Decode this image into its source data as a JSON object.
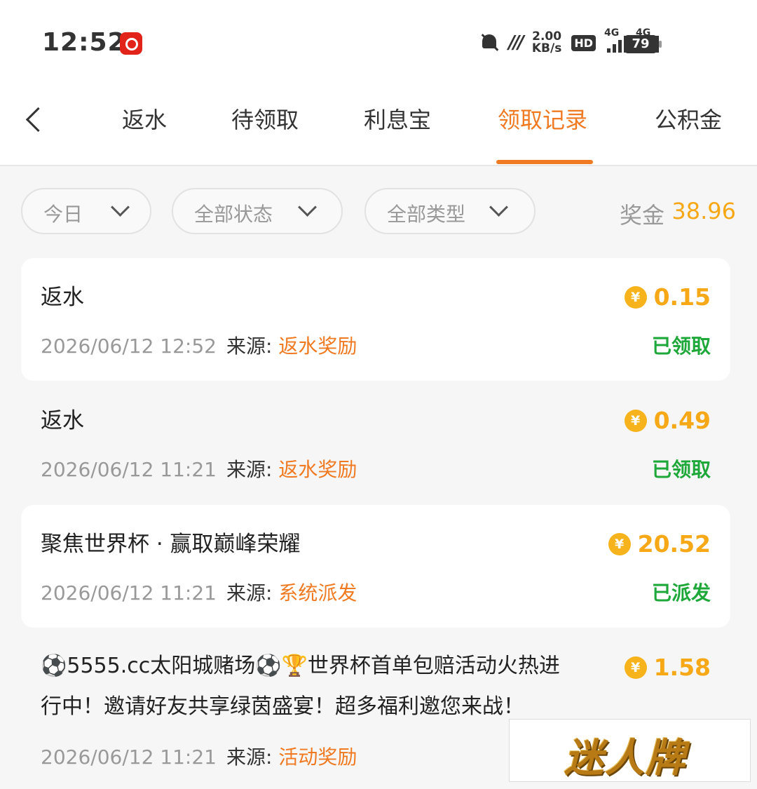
{
  "status_bar": {
    "time": "12:52",
    "speed_value": "2.00",
    "speed_unit": "KB/s",
    "hd_label": "HD",
    "sim1_label": "4G",
    "sim2_label": "4G",
    "battery": "79"
  },
  "header": {
    "tabs": [
      {
        "label": "返水"
      },
      {
        "label": "待领取"
      },
      {
        "label": "利息宝"
      },
      {
        "label": "领取记录"
      },
      {
        "label": "公积金"
      }
    ],
    "active_tab": "领取记录"
  },
  "filters": {
    "date": "今日",
    "status": "全部状态",
    "type": "全部类型",
    "bonus_label": "奖金",
    "bonus_value": "38.96"
  },
  "source_label": "来源:",
  "records": [
    {
      "title": "返水",
      "amount": "0.15",
      "time": "2026/06/12 12:52",
      "source": "返水奖励",
      "status": "已领取"
    },
    {
      "title": "返水",
      "amount": "0.49",
      "time": "2026/06/12 11:21",
      "source": "返水奖励",
      "status": "已领取"
    },
    {
      "title": "聚焦世界杯 · 赢取巅峰荣耀",
      "amount": "20.52",
      "time": "2026/06/12 11:21",
      "source": "系统派发",
      "status": "已派发"
    },
    {
      "title_line1": "⚽5555.cc太阳城赌场⚽🏆世界杯首单包赔活动火热进",
      "title_line2": "行中！邀请好友共享绿茵盛宴！超多福利邀您来战！",
      "amount": "1.58",
      "time": "2026/06/12 11:21",
      "source": "活动奖励"
    }
  ],
  "coin_symbol": "¥",
  "watermark": "迷人牌",
  "colors": {
    "accent": "#f07a22",
    "gold": "#f6a817",
    "success": "#1fa83a"
  }
}
